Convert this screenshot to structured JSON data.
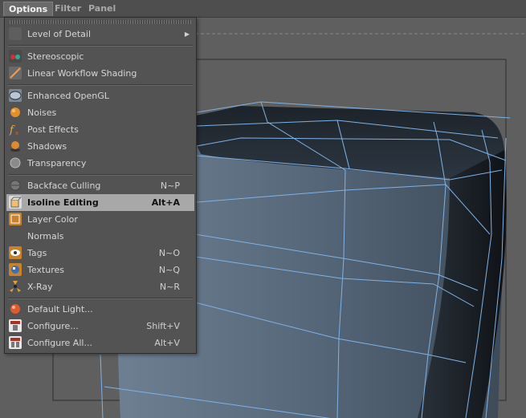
{
  "menubar": {
    "items": [
      "Options",
      "Filter",
      "Panel"
    ]
  },
  "menu": {
    "groups": [
      [
        {
          "label": "Level of Detail",
          "shortcut": "",
          "icon": "blank-icon",
          "submenu": true
        }
      ],
      [
        {
          "label": "Stereoscopic",
          "shortcut": "",
          "icon": "stereoscopic-icon"
        },
        {
          "label": "Linear Workflow Shading",
          "shortcut": "",
          "icon": "linear-workflow-icon"
        }
      ],
      [
        {
          "label": "Enhanced OpenGL",
          "shortcut": "",
          "icon": "opengl-icon"
        },
        {
          "label": "Noises",
          "shortcut": "",
          "icon": "noises-icon"
        },
        {
          "label": "Post Effects",
          "shortcut": "",
          "icon": "post-effects-icon"
        },
        {
          "label": "Shadows",
          "shortcut": "",
          "icon": "shadows-icon"
        },
        {
          "label": "Transparency",
          "shortcut": "",
          "icon": "transparency-icon"
        }
      ],
      [
        {
          "label": "Backface Culling",
          "shortcut": "N~P",
          "icon": "backface-culling-icon"
        },
        {
          "label": "Isoline Editing",
          "shortcut": "Alt+A",
          "icon": "isoline-editing-icon",
          "highlighted": true
        },
        {
          "label": "Layer Color",
          "shortcut": "",
          "icon": "layer-color-icon"
        },
        {
          "label": "Normals",
          "shortcut": "",
          "icon": "blank-icon"
        },
        {
          "label": "Tags",
          "shortcut": "N~O",
          "icon": "tags-icon"
        },
        {
          "label": "Textures",
          "shortcut": "N~Q",
          "icon": "textures-icon"
        },
        {
          "label": "X-Ray",
          "shortcut": "N~R",
          "icon": "xray-icon"
        }
      ],
      [
        {
          "label": "Default Light...",
          "shortcut": "",
          "icon": "default-light-icon"
        },
        {
          "label": "Configure...",
          "shortcut": "Shift+V",
          "icon": "configure-icon"
        },
        {
          "label": "Configure All...",
          "shortcut": "Alt+V",
          "icon": "configure-all-icon"
        }
      ]
    ]
  },
  "colors": {
    "highlight": "#a8a8a8",
    "wire": "#7fb2e6",
    "menu_bg": "#535353",
    "viewport_bg": "#5f5f5f"
  }
}
